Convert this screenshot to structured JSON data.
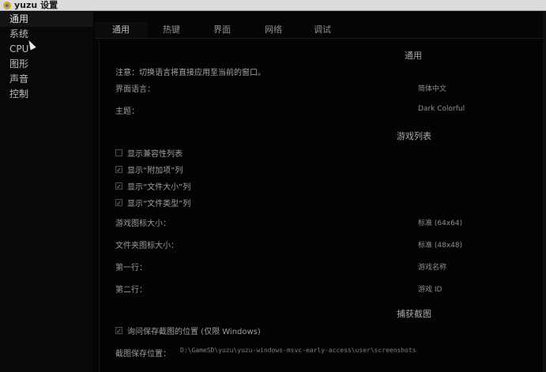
{
  "window": {
    "title": "yuzu 设置"
  },
  "sidebar": {
    "items": [
      {
        "label": "通用"
      },
      {
        "label": "系统"
      },
      {
        "label": "CPU"
      },
      {
        "label": "图形"
      },
      {
        "label": "声音"
      },
      {
        "label": "控制"
      }
    ]
  },
  "tabs": [
    {
      "label": "通用"
    },
    {
      "label": "热键"
    },
    {
      "label": "界面"
    },
    {
      "label": "网络"
    },
    {
      "label": "调试"
    }
  ],
  "general": {
    "section_title": "通用",
    "note": "注意：切换语言将直接应用至当前的窗口。",
    "language_label": "界面语言：",
    "language_value": "简体中文",
    "theme_label": "主题：",
    "theme_value": "Dark Colorful"
  },
  "gamelist": {
    "section_title": "游戏列表",
    "checkboxes": [
      {
        "label": "显示兼容性列表",
        "checked": false
      },
      {
        "label": "显示“附加项”列",
        "checked": true
      },
      {
        "label": "显示“文件大小”列",
        "checked": true
      },
      {
        "label": "显示“文件类型”列",
        "checked": true
      }
    ],
    "game_icon_size_label": "游戏图标大小：",
    "game_icon_size_value": "标准 (64x64)",
    "folder_icon_size_label": "文件夹图标大小：",
    "folder_icon_size_value": "标准 (48x48)",
    "row1_label": "第一行：",
    "row1_value": "游戏名称",
    "row2_label": "第二行：",
    "row2_value": "游戏 ID"
  },
  "screenshots": {
    "section_title": "捕获截图",
    "ask_checkbox_label": "询问保存截图的位置 (仅限 Windows)",
    "ask_checked": true,
    "path_label": "截图保存位置：",
    "path_value": "D:\\GameSD\\yuzu\\yuzu-windows-msvc-early-access\\user\\screenshots"
  }
}
